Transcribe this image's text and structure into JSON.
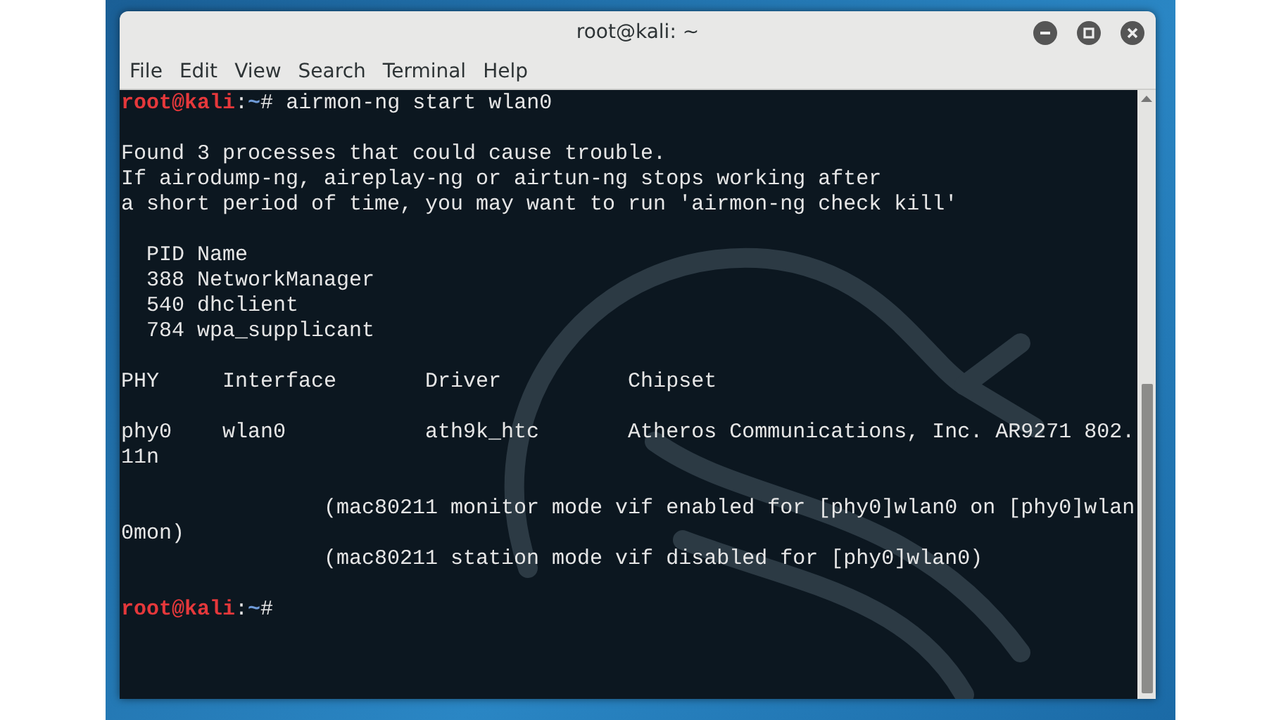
{
  "window": {
    "title": "root@kali: ~"
  },
  "menu": [
    "File",
    "Edit",
    "View",
    "Search",
    "Terminal",
    "Help"
  ],
  "terminal": {
    "lines": [
      {
        "kind": "prompt",
        "user": "root@kali",
        "separator": ":",
        "path": "~",
        "sign": "#",
        "command": "airmon-ng start wlan0"
      },
      {
        "kind": "blank"
      },
      {
        "kind": "output",
        "text": "Found 3 processes that could cause trouble."
      },
      {
        "kind": "output",
        "text": "If airodump-ng, aireplay-ng or airtun-ng stops working after"
      },
      {
        "kind": "output",
        "text": "a short period of time, you may want to run 'airmon-ng check kill'"
      },
      {
        "kind": "blank"
      },
      {
        "kind": "output",
        "text": "  PID Name"
      },
      {
        "kind": "output",
        "text": "  388 NetworkManager"
      },
      {
        "kind": "output",
        "text": "  540 dhclient"
      },
      {
        "kind": "output",
        "text": "  784 wpa_supplicant"
      },
      {
        "kind": "blank"
      },
      {
        "kind": "output",
        "text": "PHY     Interface       Driver          Chipset"
      },
      {
        "kind": "blank"
      },
      {
        "kind": "output",
        "text": "phy0    wlan0           ath9k_htc       Atheros Communications, Inc. AR9271 802."
      },
      {
        "kind": "output",
        "text": "11n"
      },
      {
        "kind": "blank"
      },
      {
        "kind": "output",
        "text": "                (mac80211 monitor mode vif enabled for [phy0]wlan0 on [phy0]wlan"
      },
      {
        "kind": "output",
        "text": "0mon)"
      },
      {
        "kind": "output",
        "text": "                (mac80211 station mode vif disabled for [phy0]wlan0)"
      },
      {
        "kind": "blank"
      },
      {
        "kind": "prompt",
        "user": "root@kali",
        "separator": ":",
        "path": "~",
        "sign": "#"
      }
    ]
  }
}
